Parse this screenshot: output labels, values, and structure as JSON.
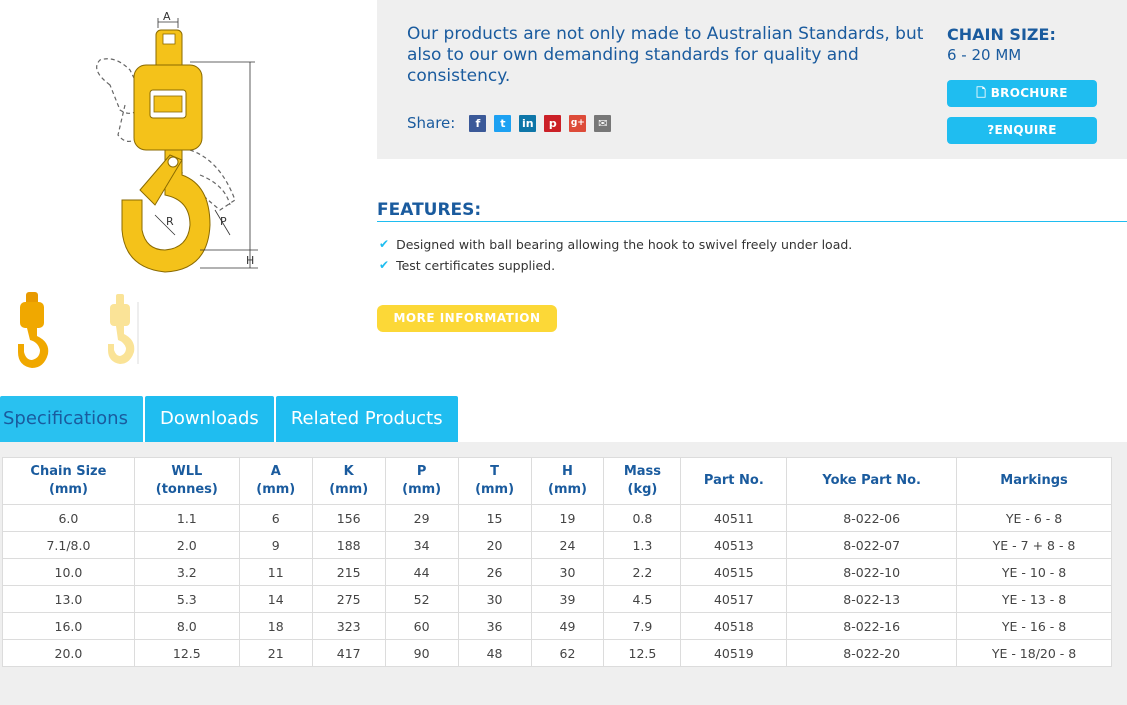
{
  "product": {
    "intro": "Our products are not only made to Australian Standards, but also to our own demanding standards for quality and consistency.",
    "share_label": "Share:",
    "chain_size_title": "CHAIN SIZE:",
    "chain_size_value": "6 - 20 MM",
    "brochure_label": "BROCHURE",
    "enquire_label": "ENQUIRE"
  },
  "diagram_labels": {
    "a": "A",
    "r": "R",
    "p": "P",
    "h": "H"
  },
  "share_icons": [
    "facebook-icon",
    "twitter-icon",
    "linkedin-icon",
    "pinterest-icon",
    "google-plus-icon",
    "email-icon"
  ],
  "features": {
    "title": "FEATURES:",
    "items": [
      "Designed with ball bearing allowing the hook to swivel freely under load.",
      "Test certificates supplied."
    ],
    "more_label": "MORE INFORMATION"
  },
  "tabs": [
    "Specifications",
    "Downloads",
    "Related Products"
  ],
  "table": {
    "headers": [
      [
        "Chain Size",
        "(mm)"
      ],
      [
        "WLL",
        "(tonnes)"
      ],
      [
        "A",
        "(mm)"
      ],
      [
        "K",
        "(mm)"
      ],
      [
        "P",
        "(mm)"
      ],
      [
        "T",
        "(mm)"
      ],
      [
        "H",
        "(mm)"
      ],
      [
        "Mass",
        "(kg)"
      ],
      [
        "Part No.",
        ""
      ],
      [
        "Yoke Part No.",
        ""
      ],
      [
        "Markings",
        ""
      ]
    ],
    "rows": [
      [
        "6.0",
        "1.1",
        "6",
        "156",
        "29",
        "15",
        "19",
        "0.8",
        "40511",
        "8-022-06",
        "YE - 6 - 8"
      ],
      [
        "7.1/8.0",
        "2.0",
        "9",
        "188",
        "34",
        "20",
        "24",
        "1.3",
        "40513",
        "8-022-07",
        "YE - 7 + 8 - 8"
      ],
      [
        "10.0",
        "3.2",
        "11",
        "215",
        "44",
        "26",
        "30",
        "2.2",
        "40515",
        "8-022-10",
        "YE - 10 - 8"
      ],
      [
        "13.0",
        "5.3",
        "14",
        "275",
        "52",
        "30",
        "39",
        "4.5",
        "40517",
        "8-022-13",
        "YE - 13 - 8"
      ],
      [
        "16.0",
        "8.0",
        "18",
        "323",
        "60",
        "36",
        "49",
        "7.9",
        "40518",
        "8-022-16",
        "YE - 16 - 8"
      ],
      [
        "20.0",
        "12.5",
        "21",
        "417",
        "90",
        "48",
        "62",
        "12.5",
        "40519",
        "8-022-20",
        "YE  - 18/20 - 8"
      ]
    ]
  },
  "colors": {
    "brand_blue": "#1a5b9e",
    "accent_cyan": "#1fbdf0",
    "button_yellow": "#fcd837",
    "hook_yellow": "#f4c21a"
  }
}
